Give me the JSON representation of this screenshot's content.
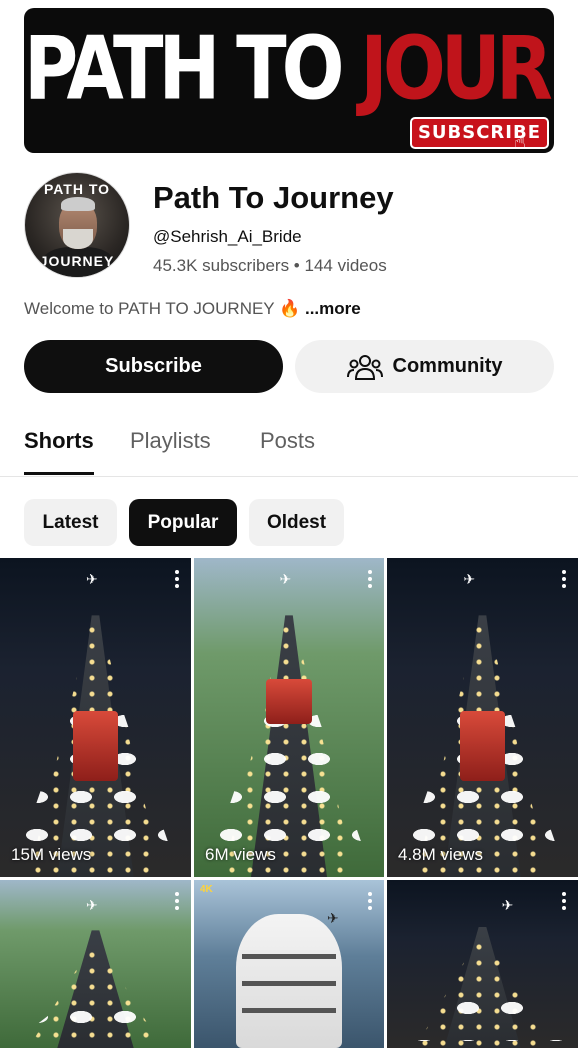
{
  "banner": {
    "title_word1": "PATH TO",
    "title_word2": "JOURNEY",
    "subscribe_label": "SUBSCRIBE"
  },
  "channel": {
    "avatar_text_top": "PATH TO",
    "avatar_text_bottom": "JOURNEY",
    "name": "Path To Journey",
    "handle": "@Sehrish_Ai_Bride",
    "subscribers": "45.3K subscribers",
    "separator": " • ",
    "videos": "144 videos",
    "description": "Welcome to PATH TO JOURNEY 🔥",
    "more_label": "...more"
  },
  "actions": {
    "subscribe_label": "Subscribe",
    "community_label": "Community"
  },
  "tabs": [
    {
      "label": "Shorts",
      "active": true
    },
    {
      "label": "Playlists",
      "active": false
    },
    {
      "label": "Posts",
      "active": false
    }
  ],
  "chips": [
    {
      "label": "Latest",
      "active": false
    },
    {
      "label": "Popular",
      "active": true
    },
    {
      "label": "Oldest",
      "active": false
    }
  ],
  "shorts": [
    {
      "views": "15M views",
      "scene": "night"
    },
    {
      "views": "6M views",
      "scene": "day"
    },
    {
      "views": "4.8M views",
      "scene": "night"
    },
    {
      "views": "",
      "scene": "day"
    },
    {
      "views": "",
      "scene": "sea",
      "badge": "4K"
    },
    {
      "views": "",
      "scene": "night"
    }
  ],
  "colors": {
    "brand_red": "#c0141b",
    "text_primary": "#0f0f0f",
    "text_secondary": "#606060",
    "chip_bg": "#f1f1f1"
  },
  "icons": {
    "community": "people-group-icon",
    "more": "more-vert-icon",
    "cursor": "hand-pointer-icon"
  }
}
